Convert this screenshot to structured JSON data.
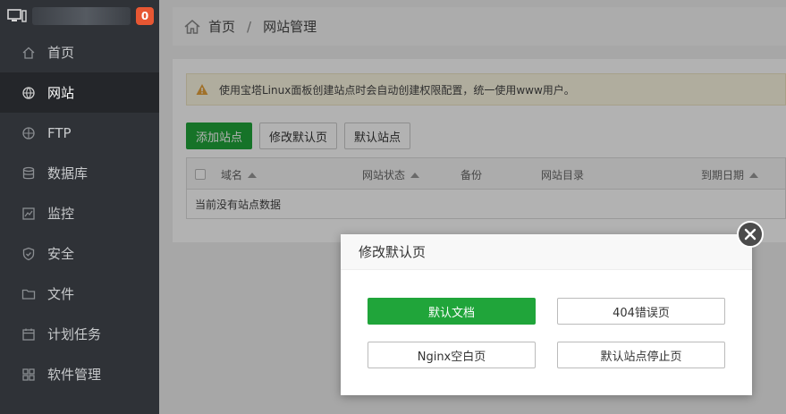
{
  "sidebar": {
    "badge": "0",
    "items": [
      {
        "label": "首页",
        "icon": "home-icon"
      },
      {
        "label": "网站",
        "icon": "globe-icon",
        "active": true
      },
      {
        "label": "FTP",
        "icon": "ftp-icon"
      },
      {
        "label": "数据库",
        "icon": "database-icon"
      },
      {
        "label": "监控",
        "icon": "monitor-icon"
      },
      {
        "label": "安全",
        "icon": "shield-icon"
      },
      {
        "label": "文件",
        "icon": "folder-icon"
      },
      {
        "label": "计划任务",
        "icon": "calendar-icon"
      },
      {
        "label": "软件管理",
        "icon": "grid-icon"
      }
    ]
  },
  "breadcrumb": {
    "home": "首页",
    "separator": "/",
    "current": "网站管理"
  },
  "notice": {
    "text": "使用宝塔Linux面板创建站点时会自动创建权限配置，统一使用www用户。"
  },
  "toolbar": {
    "add_site": "添加站点",
    "edit_default_page": "修改默认页",
    "default_site": "默认站点"
  },
  "table": {
    "columns": [
      "域名",
      "网站状态",
      "备份",
      "网站目录",
      "到期日期"
    ],
    "empty_text": "当前没有站点数据"
  },
  "modal": {
    "title": "修改默认页",
    "buttons": [
      "默认文档",
      "404错误页",
      "Nginx空白页",
      "默认站点停止页"
    ]
  },
  "colors": {
    "accent": "#20a53a",
    "sidebar_bg": "#2f3237",
    "badge": "#e75733"
  }
}
